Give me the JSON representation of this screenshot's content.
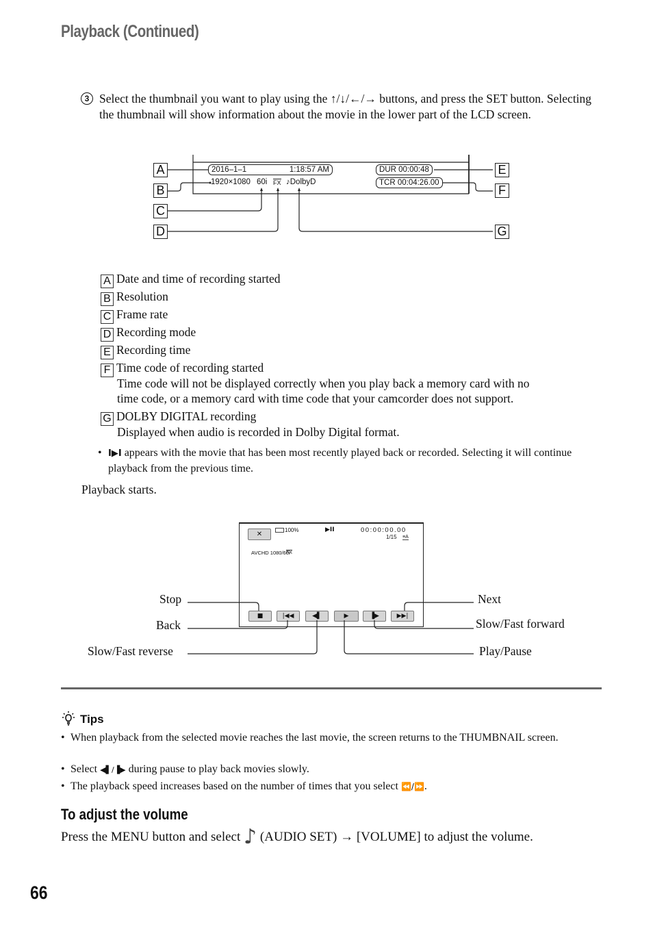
{
  "header": {
    "title": "Playback (Continued)"
  },
  "step3": {
    "number": "3",
    "text": "Select the thumbnail you want to play using the ↑/↓/←/→ buttons, and press the SET button. Selecting the thumbnail will show information about the movie in the lower part of the LCD screen."
  },
  "info_diagram": {
    "date": "2016–1–1",
    "time": "1:18:57 AM",
    "resolution": "1920×1080",
    "frame_rate": "60i",
    "rec_mode": "FX",
    "audio": "♪DolbyD",
    "duration": "DUR   00:00:48",
    "timecode": "TCR   00:04:26.00",
    "labels": {
      "A": "A",
      "B": "B",
      "C": "C",
      "D": "D",
      "E": "E",
      "F": "F",
      "G": "G"
    }
  },
  "legend": [
    {
      "key": "A",
      "text": "Date and time of recording started"
    },
    {
      "key": "B",
      "text": "Resolution"
    },
    {
      "key": "C",
      "text": "Frame rate"
    },
    {
      "key": "D",
      "text": "Recording mode"
    },
    {
      "key": "E",
      "text": "Recording time"
    },
    {
      "key": "F",
      "text": "Time code of recording started",
      "sub": [
        "Time code will not be displayed correctly when you play back a memory card with no",
        "time code, or a memory card with time code that your camcorder does not support."
      ]
    },
    {
      "key": "G",
      "text": "DOLBY DIGITAL recording",
      "sub": [
        "Displayed when audio is recorded in Dolby Digital format."
      ]
    }
  ],
  "note": {
    "bullet": "•",
    "icon": "▶",
    "text": "appears with the movie that has been most recently played back or recorded. Selecting it will continue playback from the previous time."
  },
  "playback_starts": "Playback starts.",
  "lcd": {
    "close_label": "✕",
    "battery": "100%",
    "play_pause_icon": "▶II",
    "counter": "00:00:00.00",
    "index": "1/15",
    "format": "AVCHD 1080/60i",
    "mode": "FX",
    "buttons": [
      "■",
      "|◀◀",
      "◀▌",
      "▶",
      "▐▶",
      "▶▶|"
    ]
  },
  "callouts": {
    "stop": "Stop",
    "back": "Back",
    "slow_fast_reverse": "Slow/Fast reverse",
    "next": "Next",
    "slow_fast_forward": "Slow/Fast forward",
    "play_pause": "Play/Pause"
  },
  "tips": {
    "title": "Tips",
    "items": [
      {
        "text": "When playback from the selected movie reaches the last movie, the screen returns to the THUMBNAIL screen."
      },
      {
        "pre": "Select ",
        "icon": "◀▌/▐▶",
        "post": " during pause to play back movies slowly."
      },
      {
        "pre": "The playback speed increases based on the number of times that you select ",
        "icon": "⏪/⏩",
        "post": "."
      }
    ]
  },
  "volume": {
    "title": "To adjust the volume",
    "pre": "Press the MENU button and select ",
    "icon": "♪",
    "post": " (AUDIO SET) → [VOLUME] to adjust the volume."
  },
  "page_number": "66"
}
